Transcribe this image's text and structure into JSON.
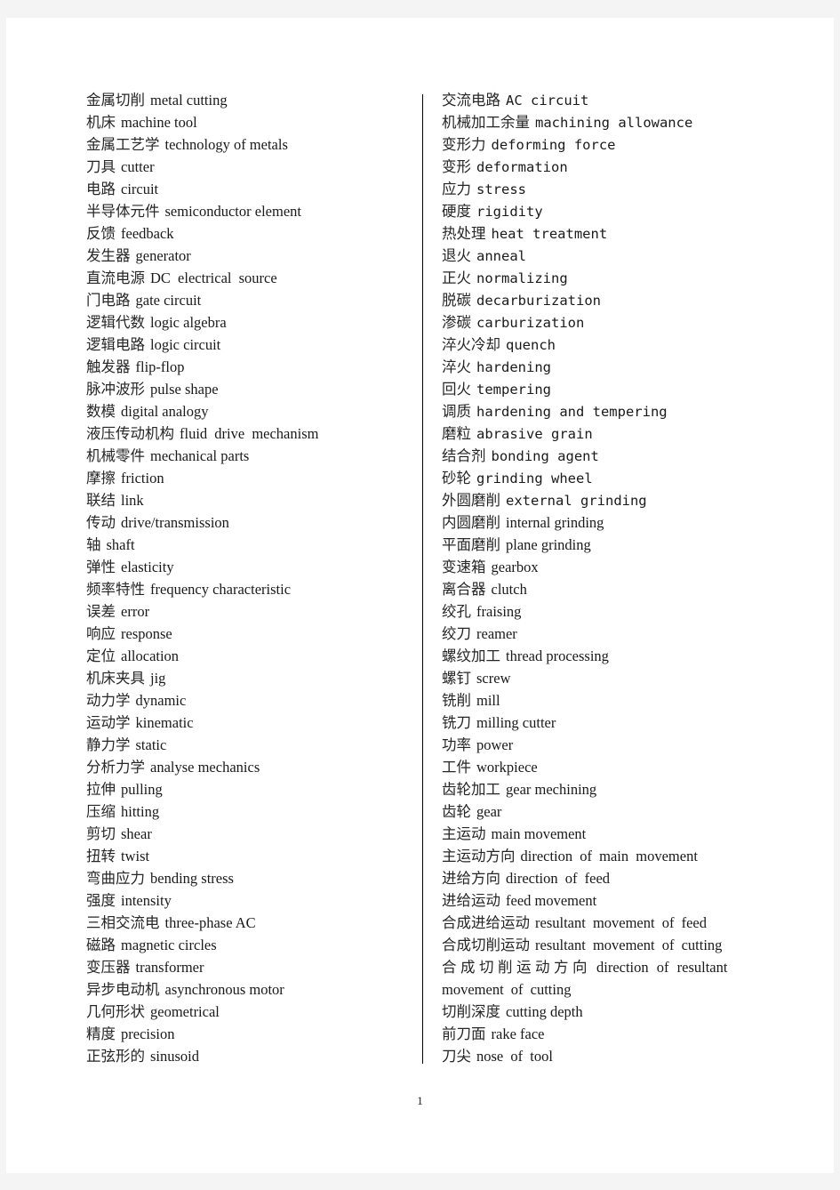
{
  "page": {
    "number": "1",
    "background_color": "#f4f4f4",
    "paper_color": "#ffffff",
    "text_color": "#1a1a1a"
  },
  "divider": {
    "color": "#000000"
  },
  "glossary": {
    "left_column": [
      {
        "zh": "金属切削",
        "en": "metal cutting",
        "style": "serif"
      },
      {
        "zh": "机床",
        "en": "machine tool",
        "style": "serif"
      },
      {
        "zh": "金属工艺学",
        "en": "technology of metals",
        "style": "serif"
      },
      {
        "zh": "刀具",
        "en": "cutter",
        "style": "serif"
      },
      {
        "zh": "电路",
        "en": "circuit",
        "style": "serif"
      },
      {
        "zh": "半导体元件",
        "en": "semiconductor element",
        "style": "serif"
      },
      {
        "zh": "反馈",
        "en": "feedback",
        "style": "serif"
      },
      {
        "zh": "发生器",
        "en": "generator",
        "style": "serif"
      },
      {
        "zh": "直流电源",
        "en": "DC electrical source",
        "style": "serif",
        "spaced": true
      },
      {
        "zh": "门电路",
        "en": "gate circuit",
        "style": "serif"
      },
      {
        "zh": "逻辑代数",
        "en": "logic algebra",
        "style": "serif"
      },
      {
        "zh": "逻辑电路",
        "en": "logic circuit",
        "style": "serif"
      },
      {
        "zh": "触发器",
        "en": "flip-flop",
        "style": "serif"
      },
      {
        "zh": "脉冲波形",
        "en": "pulse shape",
        "style": "serif"
      },
      {
        "zh": "数模",
        "en": "digital analogy",
        "style": "serif"
      },
      {
        "zh": "液压传动机构",
        "en": "fluid drive mechanism",
        "style": "serif",
        "spaced": true
      },
      {
        "zh": "机械零件",
        "en": "mechanical parts",
        "style": "serif"
      },
      {
        "zh": "摩擦",
        "en": "friction",
        "style": "serif"
      },
      {
        "zh": "联结",
        "en": "link",
        "style": "serif"
      },
      {
        "zh": "传动",
        "en": "drive/transmission",
        "style": "serif"
      },
      {
        "zh": "轴",
        "en": "shaft",
        "style": "serif"
      },
      {
        "zh": "弹性",
        "en": "elasticity",
        "style": "serif"
      },
      {
        "zh": "频率特性",
        "en": "frequency characteristic",
        "style": "serif"
      },
      {
        "zh": "误差",
        "en": "error",
        "style": "serif"
      },
      {
        "zh": "响应",
        "en": "response",
        "style": "serif"
      },
      {
        "zh": "定位",
        "en": "allocation",
        "style": "serif"
      },
      {
        "zh": "机床夹具",
        "en": "jig",
        "style": "serif"
      },
      {
        "zh": "动力学",
        "en": "dynamic",
        "style": "serif"
      },
      {
        "zh": "运动学",
        "en": "kinematic",
        "style": "serif"
      },
      {
        "zh": "静力学",
        "en": "static",
        "style": "serif"
      },
      {
        "zh": "分析力学",
        "en": "analyse mechanics",
        "style": "serif"
      },
      {
        "zh": "拉伸",
        "en": "pulling",
        "style": "serif"
      },
      {
        "zh": "压缩",
        "en": "hitting",
        "style": "serif"
      },
      {
        "zh": "剪切",
        "en": "shear",
        "style": "serif"
      },
      {
        "zh": "扭转",
        "en": "twist",
        "style": "serif"
      },
      {
        "zh": "弯曲应力",
        "en": "bending stress",
        "style": "serif"
      },
      {
        "zh": "强度",
        "en": "intensity",
        "style": "serif"
      },
      {
        "zh": "三相交流电",
        "en": "three-phase AC",
        "style": "serif"
      },
      {
        "zh": "磁路",
        "en": "magnetic circles",
        "style": "serif"
      },
      {
        "zh": "变压器",
        "en": "transformer",
        "style": "serif"
      },
      {
        "zh": "异步电动机",
        "en": "asynchronous motor",
        "style": "serif"
      },
      {
        "zh": "几何形状",
        "en": "geometrical",
        "style": "serif"
      },
      {
        "zh": "精度",
        "en": "precision",
        "style": "serif"
      },
      {
        "zh": "正弦形的",
        "en": "sinusoid",
        "style": "serif"
      }
    ],
    "right_column": [
      {
        "zh": "交流电路",
        "en": "AC circuit",
        "style": "mono"
      },
      {
        "zh": "机械加工余量",
        "en": "machining allowance",
        "style": "mono"
      },
      {
        "zh": "变形力",
        "en": "deforming force",
        "style": "mono"
      },
      {
        "zh": "变形",
        "en": "deformation",
        "style": "mono"
      },
      {
        "zh": "应力",
        "en": "stress",
        "style": "mono"
      },
      {
        "zh": "硬度",
        "en": "rigidity",
        "style": "mono"
      },
      {
        "zh": "热处理",
        "en": "heat treatment",
        "style": "mono"
      },
      {
        "zh": "退火",
        "en": "anneal",
        "style": "mono"
      },
      {
        "zh": "正火",
        "en": "normalizing",
        "style": "mono"
      },
      {
        "zh": "脱碳",
        "en": "decarburization",
        "style": "mono"
      },
      {
        "zh": "渗碳",
        "en": "carburization",
        "style": "mono"
      },
      {
        "zh": "淬火冷却",
        "en": "quench",
        "style": "mono"
      },
      {
        "zh": "淬火",
        "en": "hardening",
        "style": "mono"
      },
      {
        "zh": "回火",
        "en": "tempering",
        "style": "mono"
      },
      {
        "zh": "调质",
        "en": "hardening and tempering",
        "style": "mono"
      },
      {
        "zh": "磨粒",
        "en": "abrasive grain",
        "style": "mono"
      },
      {
        "zh": "结合剂",
        "en": "bonding agent",
        "style": "mono"
      },
      {
        "zh": "砂轮",
        "en": "grinding wheel",
        "style": "mono"
      },
      {
        "zh": "外圆磨削",
        "en": "external grinding",
        "style": "mono"
      },
      {
        "zh": "内圆磨削",
        "en": "internal grinding",
        "style": "serif"
      },
      {
        "zh": "平面磨削",
        "en": "plane grinding",
        "style": "serif"
      },
      {
        "zh": "变速箱",
        "en": "gearbox",
        "style": "serif"
      },
      {
        "zh": "离合器",
        "en": "clutch",
        "style": "serif"
      },
      {
        "zh": "绞孔",
        "en": "fraising",
        "style": "serif"
      },
      {
        "zh": "绞刀",
        "en": "reamer",
        "style": "serif"
      },
      {
        "zh": "螺纹加工",
        "en": "thread processing",
        "style": "serif"
      },
      {
        "zh": "螺钉",
        "en": "screw",
        "style": "serif"
      },
      {
        "zh": "铣削",
        "en": "mill",
        "style": "serif"
      },
      {
        "zh": "铣刀",
        "en": "milling cutter",
        "style": "serif"
      },
      {
        "zh": "功率",
        "en": "power",
        "style": "serif"
      },
      {
        "zh": "工件",
        "en": "workpiece",
        "style": "serif"
      },
      {
        "zh": "齿轮加工",
        "en": "gear mechining",
        "style": "serif"
      },
      {
        "zh": "齿轮",
        "en": "gear",
        "style": "serif"
      },
      {
        "zh": "主运动",
        "en": "main movement",
        "style": "serif"
      },
      {
        "zh": "主运动方向",
        "en": "direction of main movement",
        "style": "serif",
        "spaced": true
      },
      {
        "zh": "进给方向",
        "en": "direction of feed",
        "style": "serif",
        "spaced": true
      },
      {
        "zh": "进给运动",
        "en": "feed movement",
        "style": "serif"
      },
      {
        "zh": "合成进给运动",
        "en": "resultant movement of feed",
        "style": "serif",
        "spaced": true
      },
      {
        "zh": "合成切削运动",
        "en": "resultant movement of cutting",
        "style": "serif",
        "spaced": true
      },
      {
        "zh": "合成切削运动方向",
        "en": "direction of resultant",
        "en_line2": "movement of cutting",
        "style": "serif",
        "wrap": true
      },
      {
        "zh": "切削深度",
        "en": "cutting depth",
        "style": "serif"
      },
      {
        "zh": "前刀面",
        "en": "rake face",
        "style": "serif"
      },
      {
        "zh": "刀尖",
        "en": "nose of tool",
        "style": "serif",
        "spaced": true
      }
    ]
  }
}
